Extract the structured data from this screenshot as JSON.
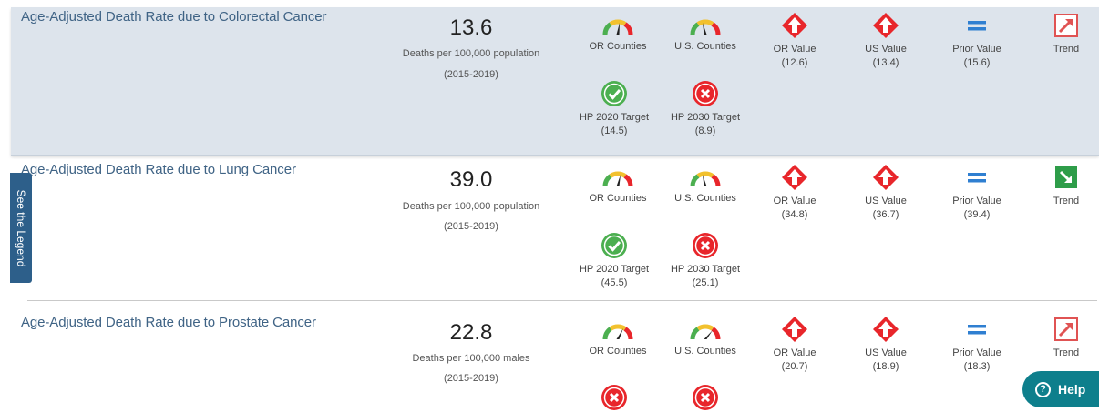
{
  "legend_tab": "See the Legend",
  "help_button": "Help",
  "indicators": [
    {
      "title": "Age-Adjusted Death Rate due to Colorectal Cancer",
      "value": "13.6",
      "unit": "Deaths per 100,000 population",
      "period": "(2015-2019)",
      "or_counties": "OR Counties",
      "us_counties": "U.S. Counties",
      "or_value_label": "OR Value",
      "or_value": "(12.6)",
      "us_value_label": "US Value",
      "us_value": "(13.4)",
      "prior_value_label": "Prior Value",
      "prior_value": "(15.6)",
      "trend_label": "Trend",
      "hp2020_label": "HP 2020 Target",
      "hp2020_value": "(14.5)",
      "hp2030_label": "HP 2030 Target",
      "hp2030_value": "(8.9)"
    },
    {
      "title": "Age-Adjusted Death Rate due to Lung Cancer",
      "value": "39.0",
      "unit": "Deaths per 100,000 population",
      "period": "(2015-2019)",
      "or_counties": "OR Counties",
      "us_counties": "U.S. Counties",
      "or_value_label": "OR Value",
      "or_value": "(34.8)",
      "us_value_label": "US Value",
      "us_value": "(36.7)",
      "prior_value_label": "Prior Value",
      "prior_value": "(39.4)",
      "trend_label": "Trend",
      "hp2020_label": "HP 2020 Target",
      "hp2020_value": "(45.5)",
      "hp2030_label": "HP 2030 Target",
      "hp2030_value": "(25.1)"
    },
    {
      "title": "Age-Adjusted Death Rate due to Prostate Cancer",
      "value": "22.8",
      "unit": "Deaths per 100,000 males",
      "period": "(2015-2019)",
      "or_counties": "OR Counties",
      "us_counties": "U.S. Counties",
      "or_value_label": "OR Value",
      "or_value": "(20.7)",
      "us_value_label": "US Value",
      "us_value": "(18.9)",
      "prior_value_label": "Prior Value",
      "prior_value": "(18.3)",
      "trend_label": "Trend"
    }
  ],
  "colors": {
    "title": "#3f6385",
    "row_highlight": "#dde4ec",
    "red": "#e8262b",
    "green": "#4caf50",
    "equal_blue": "#2f7fd1",
    "trend_red_border": "#e05353",
    "trend_green": "#2e9d49",
    "legend_tab": "#2d5f8a",
    "help": "#0e7f8c"
  },
  "icons": {
    "gauge": "gauge-icon",
    "diamond_up": "red-diamond-arrow-up-icon",
    "equal": "equal-icon",
    "trend_up": "trend-up-icon",
    "trend_down": "trend-down-icon",
    "check": "check-circle-icon",
    "x": "x-circle-icon"
  }
}
